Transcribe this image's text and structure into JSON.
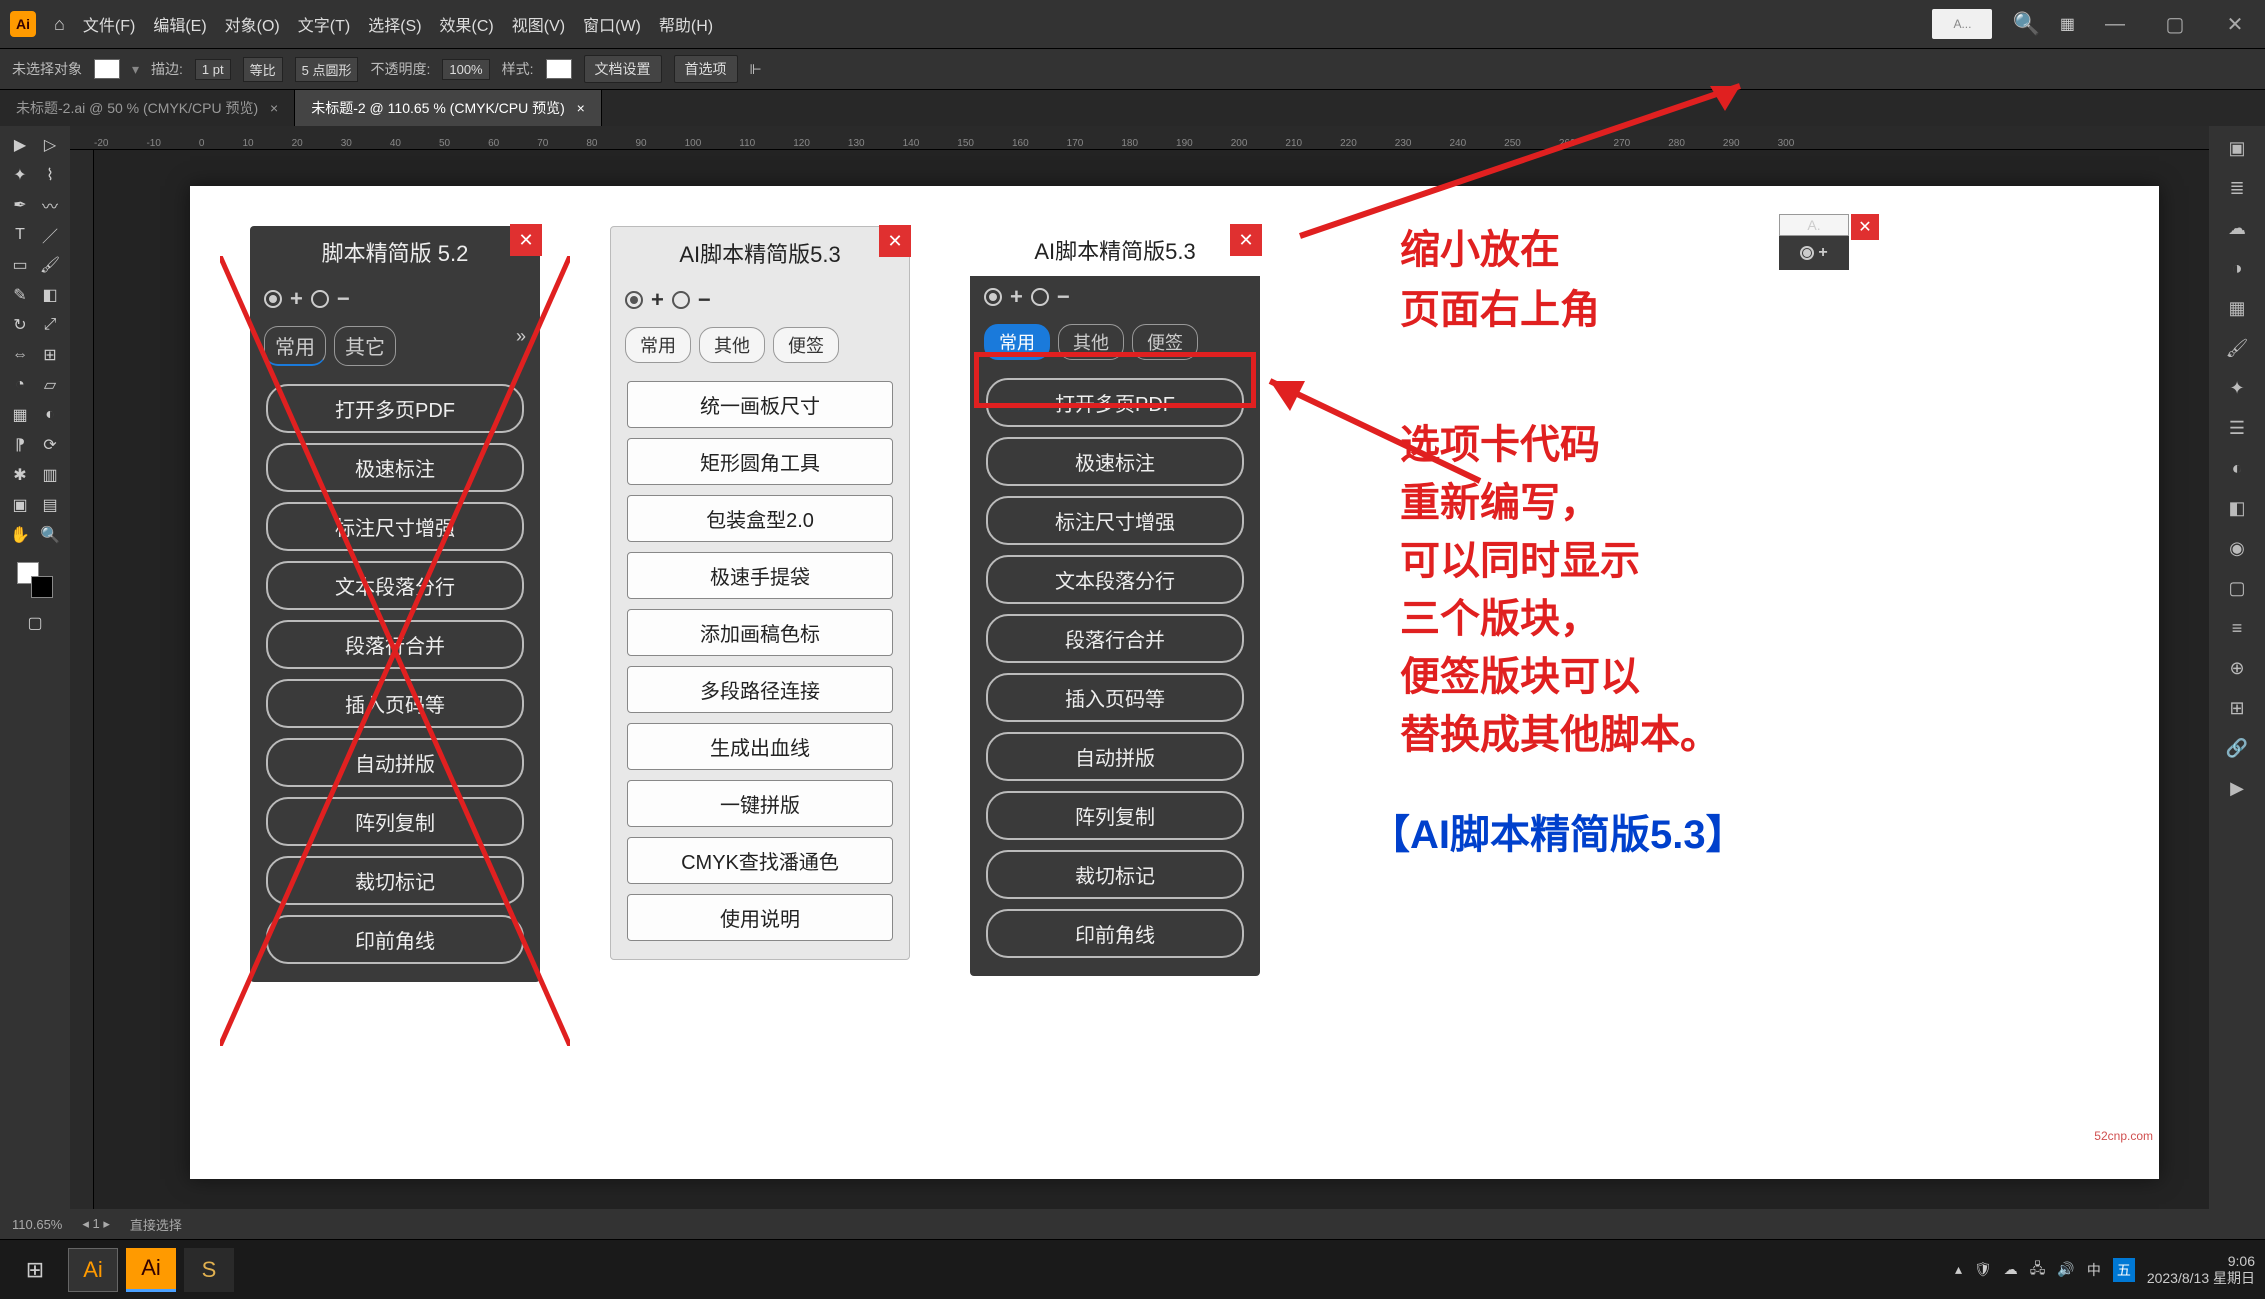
{
  "app": {
    "logo": "Ai"
  },
  "menubar": {
    "items": [
      "文件(F)",
      "编辑(E)",
      "对象(O)",
      "文字(T)",
      "选择(S)",
      "效果(C)",
      "视图(V)",
      "窗口(W)",
      "帮助(H)"
    ],
    "search_placeholder": "A..."
  },
  "optionsbar": {
    "noselection": "未选择对象",
    "stroke_label": "描边:",
    "stroke_val": "1 pt",
    "uniform": "等比",
    "brush": "5 点圆形",
    "opacity_label": "不透明度:",
    "opacity_val": "100%",
    "style_label": "样式:",
    "docsetup": "文档设置",
    "prefs": "首选项"
  },
  "doctabs": {
    "tab1": "未标题-2.ai @ 50 % (CMYK/CPU 预览)",
    "tab2": "未标题-2 @ 110.65 % (CMYK/CPU 预览)"
  },
  "ruler_marks": [
    "-20",
    "-10",
    "0",
    "10",
    "20",
    "30",
    "40",
    "50",
    "60",
    "70",
    "80",
    "90",
    "100",
    "110",
    "120",
    "130",
    "140",
    "150",
    "160",
    "170",
    "180",
    "190",
    "200",
    "210",
    "220",
    "230",
    "240",
    "250",
    "260",
    "270",
    "280",
    "290",
    "300"
  ],
  "panel52": {
    "title": "脚本精简版 5.2",
    "tabs": [
      "常用",
      "其它"
    ],
    "buttons": [
      "打开多页PDF",
      "极速标注",
      "标注尺寸增强",
      "文本段落分行",
      "段落行合并",
      "插入页码等",
      "自动拼版",
      "阵列复制",
      "裁切标记",
      "印前角线"
    ]
  },
  "panel53_light": {
    "title": "AI脚本精简版5.3",
    "tabs": [
      "常用",
      "其他",
      "便签"
    ],
    "buttons": [
      "统一画板尺寸",
      "矩形圆角工具",
      "包装盒型2.0",
      "极速手提袋",
      "添加画稿色标",
      "多段路径连接",
      "生成出血线",
      "一键拼版",
      "CMYK查找潘通色",
      "使用说明"
    ]
  },
  "panel53_dark": {
    "title": "AI脚本精简版5.3",
    "tabs": [
      "常用",
      "其他",
      "便签"
    ],
    "buttons": [
      "打开多页PDF",
      "极速标注",
      "标注尺寸增强",
      "文本段落分行",
      "段落行合并",
      "插入页码等",
      "自动拼版",
      "阵列复制",
      "裁切标记",
      "印前角线"
    ]
  },
  "mini": {
    "title": "A."
  },
  "annotations": {
    "top1": "缩小放在",
    "top2": "页面右上角",
    "body": "选项卡代码\n重新编写，\n可以同时显示\n三个版块，\n便签版块可以\n替换成其他脚本。",
    "footer": "【AI脚本精简版5.3】"
  },
  "statusbar": {
    "zoom": "110.65%",
    "tool": "直接选择"
  },
  "taskbar": {
    "time": "9:06",
    "date": "2023/8/13 星期日"
  },
  "watermark": "52cnp.com"
}
